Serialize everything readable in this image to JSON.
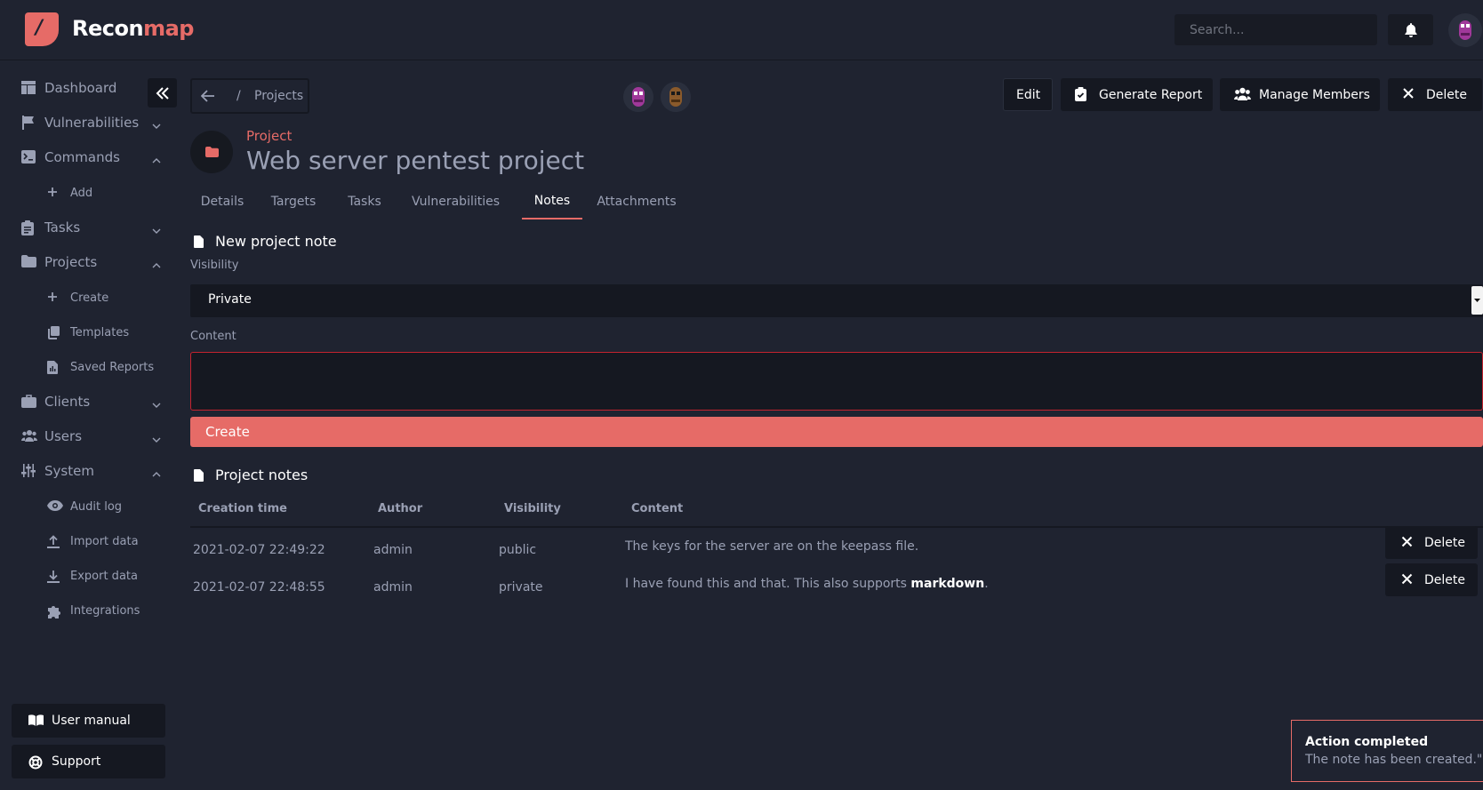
{
  "app": {
    "brand_part1": "Recon",
    "brand_part2": "map",
    "logo_glyph": "/",
    "search_placeholder": "Search..."
  },
  "colors": {
    "accent": "#e66b67",
    "background": "#1f2330",
    "surface": "#151821",
    "error_border": "#c4232f"
  },
  "sidebar": {
    "items": [
      {
        "label": "Dashboard",
        "icon": "dashboard-icon"
      },
      {
        "label": "Vulnerabilities",
        "icon": "flag-icon"
      },
      {
        "label": "Commands",
        "icon": "terminal-icon"
      },
      {
        "label": "Add",
        "icon": "plus-icon"
      },
      {
        "label": "Tasks",
        "icon": "clipboard-icon"
      },
      {
        "label": "Projects",
        "icon": "folder-icon"
      },
      {
        "label": "Create",
        "icon": "plus-icon"
      },
      {
        "label": "Templates",
        "icon": "copy-icon"
      },
      {
        "label": "Saved Reports",
        "icon": "report-icon"
      },
      {
        "label": "Clients",
        "icon": "briefcase-icon"
      },
      {
        "label": "Users",
        "icon": "users-icon"
      },
      {
        "label": "System",
        "icon": "sliders-icon"
      },
      {
        "label": "Audit log",
        "icon": "eye-icon"
      },
      {
        "label": "Import data",
        "icon": "upload-icon"
      },
      {
        "label": "Export data",
        "icon": "download-icon"
      },
      {
        "label": "Integrations",
        "icon": "puzzle-icon"
      }
    ],
    "footer": {
      "manual": "User manual",
      "support": "Support"
    }
  },
  "breadcrumb": {
    "separator": "/",
    "projects": "Projects"
  },
  "actions": {
    "edit": "Edit",
    "generate_report": "Generate Report",
    "manage_members": "Manage Members",
    "delete": "Delete"
  },
  "project": {
    "kicker": "Project",
    "title": "Web server pentest project"
  },
  "tabs": [
    "Details",
    "Targets",
    "Tasks",
    "Vulnerabilities",
    "Notes",
    "Attachments"
  ],
  "new_note": {
    "title": "New project note",
    "visibility_label": "Visibility",
    "visibility_value": "Private",
    "content_label": "Content",
    "create_label": "Create"
  },
  "notes": {
    "title": "Project notes",
    "columns": [
      "Creation time",
      "Author",
      "Visibility",
      "Content"
    ],
    "rows": [
      {
        "time": "2021-02-07 22:49:22",
        "author": "admin",
        "visibility": "public",
        "content": "The keys for the server are on the keepass file.",
        "content_bold": "",
        "content_tail": ""
      },
      {
        "time": "2021-02-07 22:48:55",
        "author": "admin",
        "visibility": "private",
        "content": "I have found this and that. This also supports ",
        "content_bold": "markdown",
        "content_tail": "."
      }
    ],
    "row_delete": "Delete"
  },
  "toast": {
    "title": "Action completed",
    "message": "The note has been created.\""
  }
}
